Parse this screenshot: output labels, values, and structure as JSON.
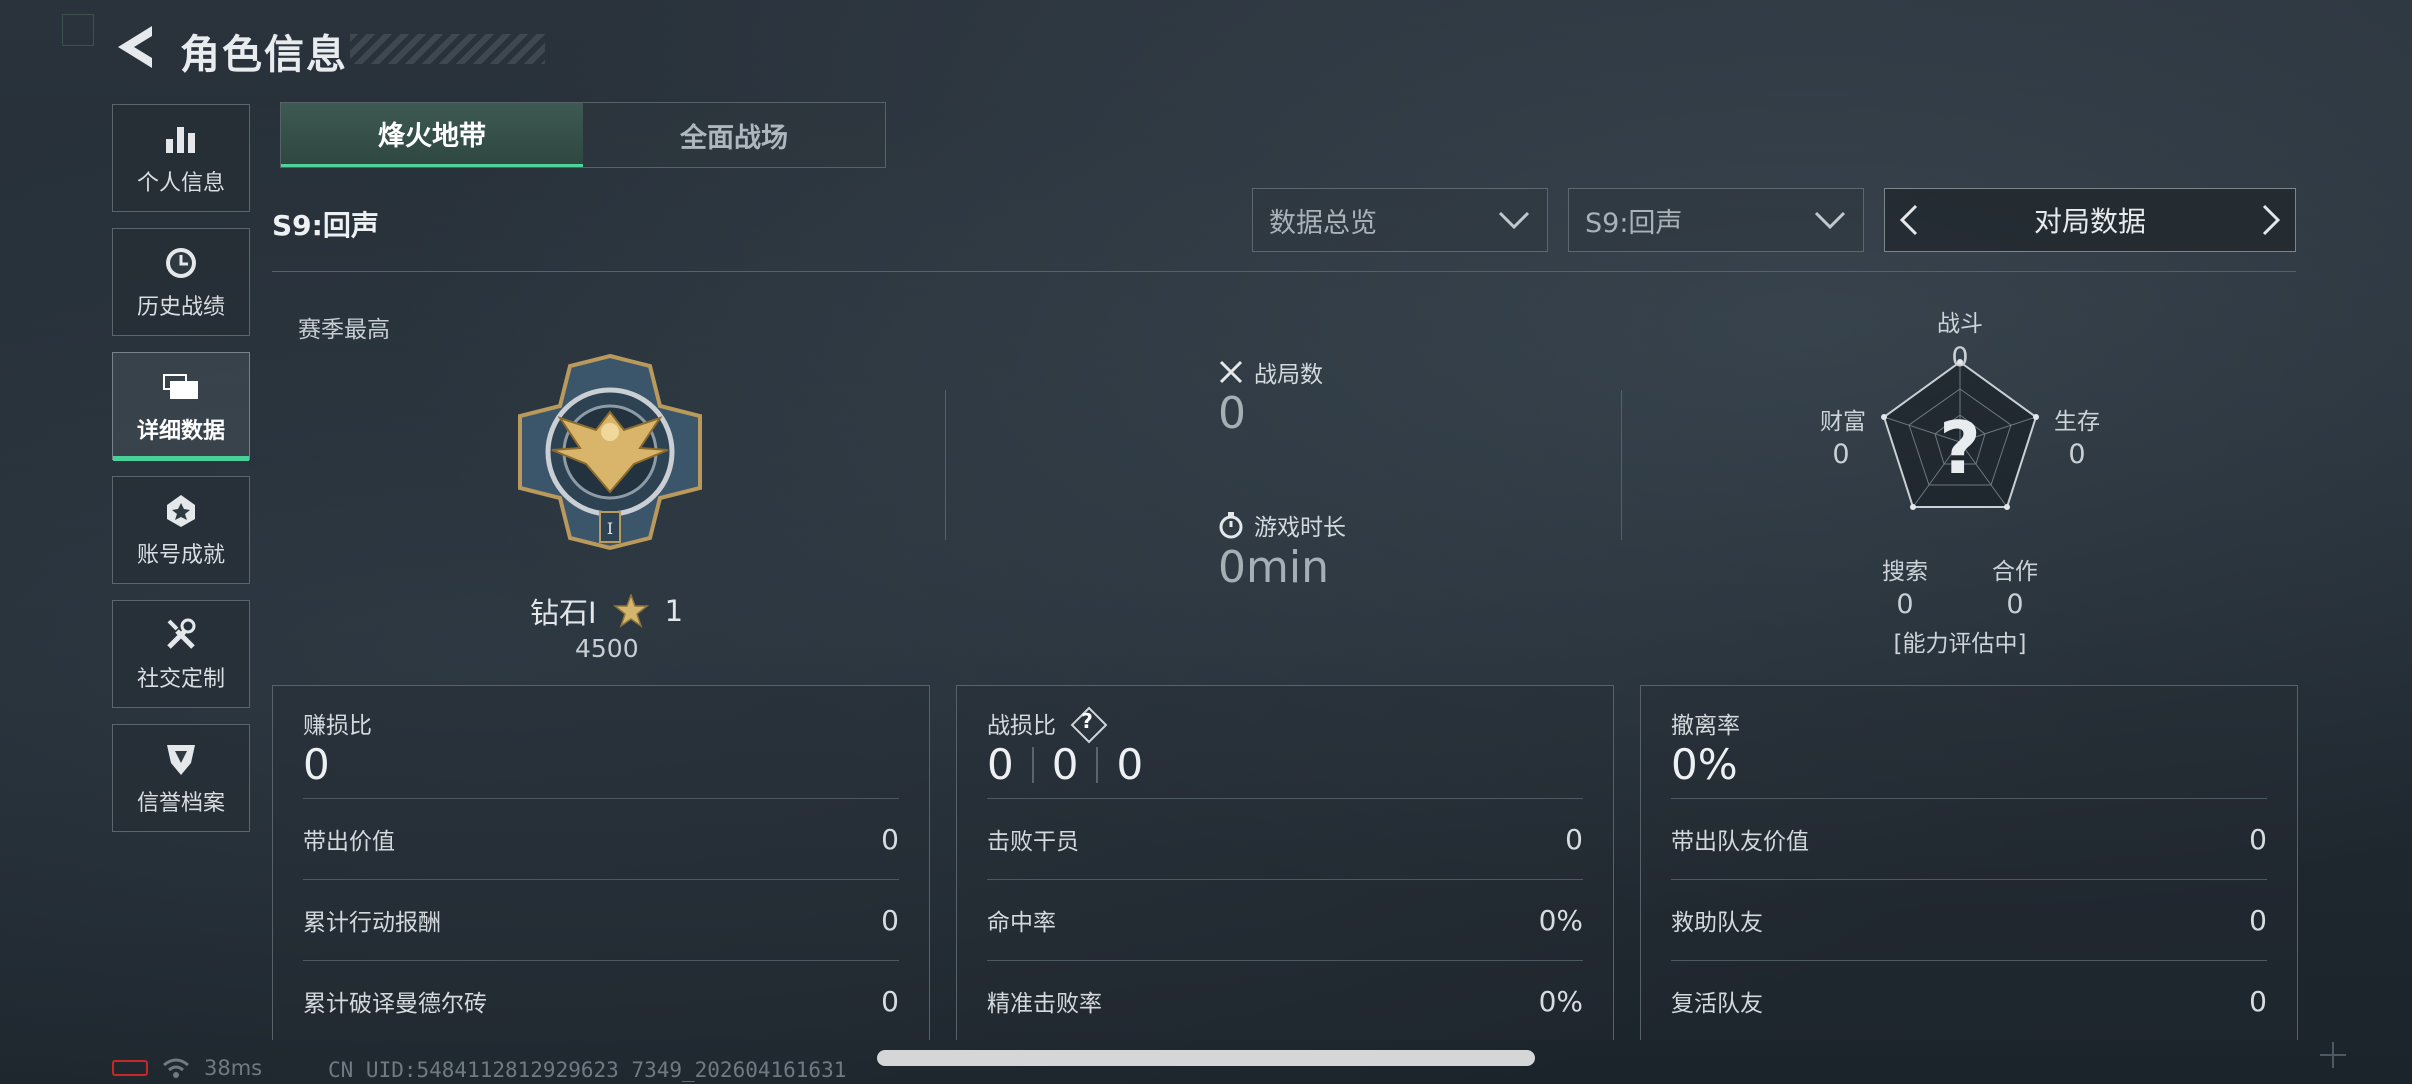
{
  "header": {
    "title": "角色信息"
  },
  "sidebar": {
    "items": [
      {
        "label": "个人信息",
        "icon": "bar-chart-icon",
        "active": false
      },
      {
        "label": "历史战绩",
        "icon": "history-clock-icon",
        "active": false
      },
      {
        "label": "详细数据",
        "icon": "folder-icon",
        "active": true
      },
      {
        "label": "账号成就",
        "icon": "achievement-icon",
        "active": false
      },
      {
        "label": "社交定制",
        "icon": "tools-icon",
        "active": false
      },
      {
        "label": "信誉档案",
        "icon": "shield-emblem-icon",
        "active": false
      }
    ]
  },
  "mode_tabs": [
    {
      "label": "烽火地带",
      "active": true
    },
    {
      "label": "全面战场",
      "active": false
    }
  ],
  "season": {
    "label": "S9:回声"
  },
  "filters": {
    "overview_select": "数据总览",
    "season_select": "S9:回声",
    "pager_title": "对局数据"
  },
  "rank": {
    "section_label": "赛季最高",
    "tier": "钻石I",
    "stars": "1",
    "score": "4500"
  },
  "stats": {
    "games_label": "战局数",
    "games_value": "0",
    "time_label": "游戏时长",
    "time_value": "0min"
  },
  "radar": {
    "center_symbol": "?",
    "status": "[能力评估中]",
    "axes": [
      {
        "label": "战斗",
        "value": "0"
      },
      {
        "label": "生存",
        "value": "0"
      },
      {
        "label": "合作",
        "value": "0"
      },
      {
        "label": "搜索",
        "value": "0"
      },
      {
        "label": "财富",
        "value": "0"
      }
    ]
  },
  "cards": [
    {
      "title": "赚损比",
      "big": "0",
      "rows": [
        {
          "k": "带出价值",
          "v": "0"
        },
        {
          "k": "累计行动报酬",
          "v": "0"
        },
        {
          "k": "累计破译曼德尔砖",
          "v": "0"
        }
      ]
    },
    {
      "title": "战损比",
      "big_parts": [
        "0",
        "0",
        "0"
      ],
      "help_symbol": "?",
      "rows": [
        {
          "k": "击败干员",
          "v": "0"
        },
        {
          "k": "命中率",
          "v": "0%"
        },
        {
          "k": "精准击败率",
          "v": "0%"
        }
      ]
    },
    {
      "title": "撤离率",
      "big": "0%",
      "rows": [
        {
          "k": "带出队友价值",
          "v": "0"
        },
        {
          "k": "救助队友",
          "v": "0"
        },
        {
          "k": "复活队友",
          "v": "0"
        }
      ]
    }
  ],
  "status_bar": {
    "ping": "38ms",
    "uid": "CN UID:5484112812929623 7349_202604161631"
  },
  "colors": {
    "accent_green": "#49d19a",
    "battery_low": "#c62828"
  }
}
